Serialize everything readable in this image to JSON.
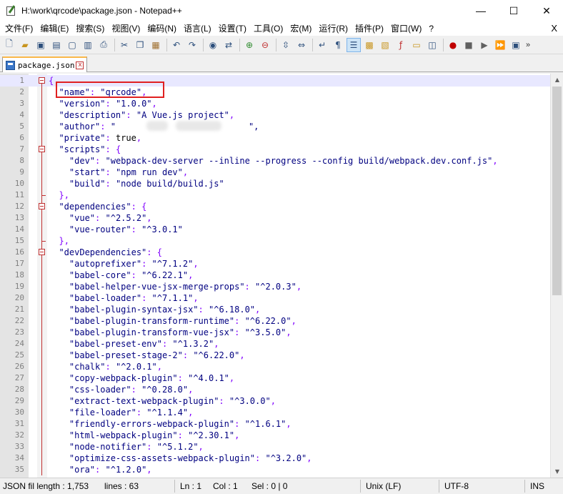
{
  "window": {
    "title": "H:\\work\\qrcode\\package.json - Notepad++",
    "minimize": "—",
    "maximize": "☐",
    "close": "✕"
  },
  "menu": {
    "items": [
      "文件(F)",
      "编辑(E)",
      "搜索(S)",
      "视图(V)",
      "编码(N)",
      "语言(L)",
      "设置(T)",
      "工具(O)",
      "宏(M)",
      "运行(R)",
      "插件(P)",
      "窗口(W)",
      "?"
    ],
    "close": "X"
  },
  "toolbar": {
    "icons": [
      "new-file-icon",
      "open-file-icon",
      "save-icon",
      "save-all-icon",
      "close-icon",
      "close-all-icon",
      "print-icon",
      "cut-icon",
      "copy-icon",
      "paste-icon",
      "undo-icon",
      "redo-icon",
      "find-icon",
      "replace-icon",
      "zoom-in-icon",
      "zoom-out-icon",
      "sync-vertical-icon",
      "sync-horizontal-icon",
      "word-wrap-icon",
      "show-all-chars-icon",
      "indent-guide-icon",
      "udl-icon",
      "doc-map-icon",
      "function-list-icon",
      "folder-workspace-icon",
      "monitoring-icon",
      "record-macro-icon",
      "stop-record-icon",
      "play-macro-icon",
      "run-multiple-icon",
      "save-macro-icon"
    ],
    "more": "»"
  },
  "tab": {
    "label": "package.json",
    "close": "x"
  },
  "editor": {
    "lines": [
      {
        "n": "1",
        "text": "{"
      },
      {
        "n": "2",
        "text": "  \"name\": \"qrcode\","
      },
      {
        "n": "3",
        "text": "  \"version\": \"1.0.0\","
      },
      {
        "n": "4",
        "text": "  \"description\": \"A Vue.js project\","
      },
      {
        "n": "5",
        "text": "  \"author\": \"",
        "tail": "\","
      },
      {
        "n": "6",
        "text": "  \"private\": true,"
      },
      {
        "n": "7",
        "text": "  \"scripts\": {"
      },
      {
        "n": "8",
        "text": "    \"dev\": \"webpack-dev-server --inline --progress --config build/webpack.dev.conf.js\","
      },
      {
        "n": "9",
        "text": "    \"start\": \"npm run dev\","
      },
      {
        "n": "10",
        "text": "    \"build\": \"node build/build.js\""
      },
      {
        "n": "11",
        "text": "  },"
      },
      {
        "n": "12",
        "text": "  \"dependencies\": {"
      },
      {
        "n": "13",
        "text": "    \"vue\": \"^2.5.2\","
      },
      {
        "n": "14",
        "text": "    \"vue-router\": \"^3.0.1\""
      },
      {
        "n": "15",
        "text": "  },"
      },
      {
        "n": "16",
        "text": "  \"devDependencies\": {"
      },
      {
        "n": "17",
        "text": "    \"autoprefixer\": \"^7.1.2\","
      },
      {
        "n": "18",
        "text": "    \"babel-core\": \"^6.22.1\","
      },
      {
        "n": "19",
        "text": "    \"babel-helper-vue-jsx-merge-props\": \"^2.0.3\","
      },
      {
        "n": "20",
        "text": "    \"babel-loader\": \"^7.1.1\","
      },
      {
        "n": "21",
        "text": "    \"babel-plugin-syntax-jsx\": \"^6.18.0\","
      },
      {
        "n": "22",
        "text": "    \"babel-plugin-transform-runtime\": \"^6.22.0\","
      },
      {
        "n": "23",
        "text": "    \"babel-plugin-transform-vue-jsx\": \"^3.5.0\","
      },
      {
        "n": "24",
        "text": "    \"babel-preset-env\": \"^1.3.2\","
      },
      {
        "n": "25",
        "text": "    \"babel-preset-stage-2\": \"^6.22.0\","
      },
      {
        "n": "26",
        "text": "    \"chalk\": \"^2.0.1\","
      },
      {
        "n": "27",
        "text": "    \"copy-webpack-plugin\": \"^4.0.1\","
      },
      {
        "n": "28",
        "text": "    \"css-loader\": \"^0.28.0\","
      },
      {
        "n": "29",
        "text": "    \"extract-text-webpack-plugin\": \"^3.0.0\","
      },
      {
        "n": "30",
        "text": "    \"file-loader\": \"^1.1.4\","
      },
      {
        "n": "31",
        "text": "    \"friendly-errors-webpack-plugin\": \"^1.6.1\","
      },
      {
        "n": "32",
        "text": "    \"html-webpack-plugin\": \"^2.30.1\","
      },
      {
        "n": "33",
        "text": "    \"node-notifier\": \"^5.1.2\","
      },
      {
        "n": "34",
        "text": "    \"optimize-css-assets-webpack-plugin\": \"^3.2.0\","
      },
      {
        "n": "35",
        "text": "    \"ora\": \"^1.2.0\","
      }
    ]
  },
  "status": {
    "file_type": "JSON fil length : 1,753",
    "lines": "lines : 63",
    "ln": "Ln : 1",
    "col": "Col : 1",
    "sel": "Sel : 0 | 0",
    "eol": "Unix (LF)",
    "encoding": "UTF-8",
    "mode": "INS"
  },
  "colors": {
    "key": "#000080",
    "string": "#000080",
    "punctuation": "#8000ff",
    "literal": "#0000ff",
    "highlight_box": "#e02020",
    "current_line": "#e8e8ff"
  }
}
